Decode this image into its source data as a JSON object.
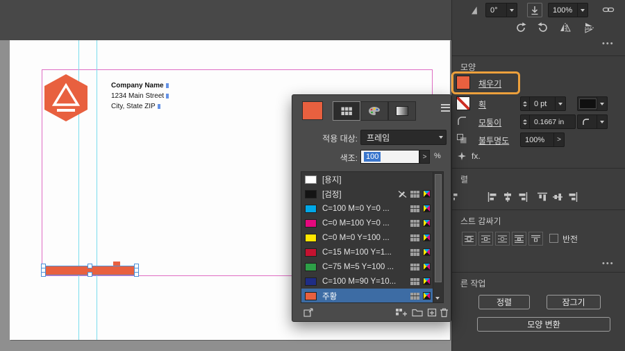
{
  "document": {
    "address": [
      "Company Name",
      "1234 Main Street",
      "City, State ZIP"
    ]
  },
  "swatches_panel": {
    "apply_label": "적용 대상:",
    "apply_value": "프레임",
    "tint_label": "색조:",
    "tint_value": "100",
    "tint_spinner": ">",
    "tint_unit": "%",
    "swatches": [
      {
        "name": "[용지]",
        "color": "#ffffff"
      },
      {
        "name": "[검정]",
        "color": "#141414"
      },
      {
        "name": "C=100 M=0 Y=0 ...",
        "color": "#00a8e8"
      },
      {
        "name": "C=0 M=100 Y=0 ...",
        "color": "#e5087e"
      },
      {
        "name": "C=0 M=0 Y=100 ...",
        "color": "#ffe600"
      },
      {
        "name": "C=15 M=100 Y=1...",
        "color": "#c41230"
      },
      {
        "name": "C=75 M=5 Y=100 ...",
        "color": "#2d9f47"
      },
      {
        "name": "C=100 M=90 Y=10...",
        "color": "#1f2d86"
      },
      {
        "name": "주황",
        "color": "#e8603f"
      }
    ]
  },
  "properties_panel": {
    "rotation_value": "0°",
    "scale_value": "100%",
    "more_icon": "•••",
    "appearance": {
      "header": "모양",
      "fill_label": "채우기",
      "fill_color": "#e8603f",
      "stroke_label": "획",
      "stroke_weight": "0 pt",
      "corner_label": "모퉁이",
      "corner_value": "0.1667 in",
      "opacity_label": "불투명도",
      "opacity_value": "100%",
      "spinner": ">",
      "fx_label": "fx."
    },
    "align": {
      "header": "렬"
    },
    "text_wrap": {
      "header": "스트 감싸기",
      "invert_label": "반전"
    },
    "quick_actions": {
      "header": "른 작업",
      "align_button": "정렬",
      "lock_button": "잠그기",
      "convert_button": "모양 변환"
    }
  },
  "colors": {
    "accent_orange": "#e8603f",
    "annotation_orange": "#eda03c",
    "selection_blue": "#4a90d9",
    "swatch_selected_row": "#3d6ca4",
    "guide_cyan": "#7adced",
    "margin_magenta": "#df6cc3"
  }
}
